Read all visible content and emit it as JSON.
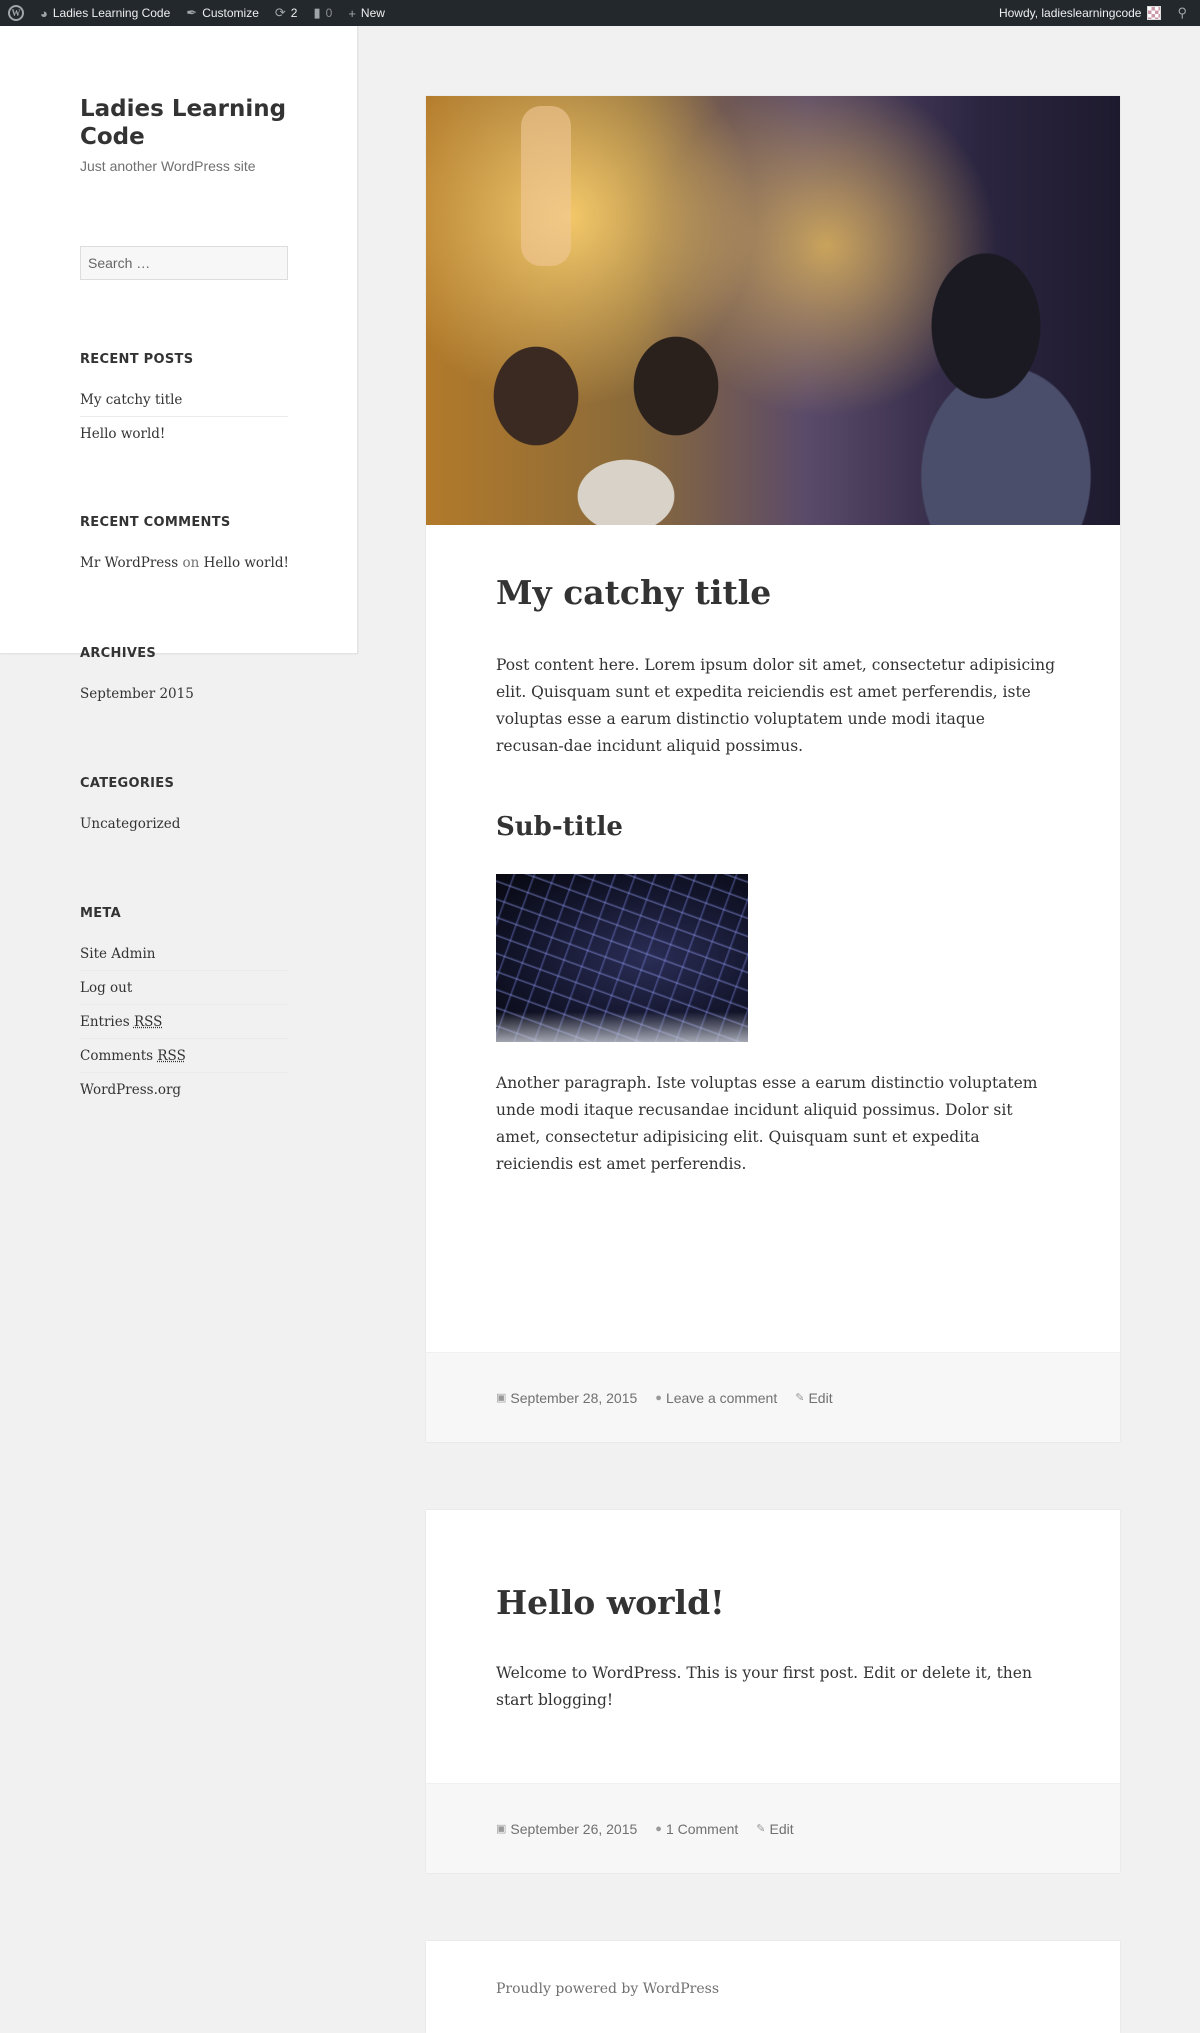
{
  "adminbar": {
    "site_name": "Ladies Learning Code",
    "customize": "Customize",
    "updates_count": "2",
    "comments_count": "0",
    "new_label": "New",
    "howdy": "Howdy, ladieslearningcode"
  },
  "site": {
    "title": "Ladies Learning Code",
    "description": "Just another WordPress site"
  },
  "search": {
    "placeholder": "Search …"
  },
  "widgets": {
    "recent_posts": {
      "title": "RECENT POSTS",
      "items": [
        "My catchy title",
        "Hello world!"
      ]
    },
    "recent_comments": {
      "title": "RECENT COMMENTS",
      "author": "Mr WordPress",
      "on": "on",
      "post": "Hello world!"
    },
    "archives": {
      "title": "ARCHIVES",
      "items": [
        "September 2015"
      ]
    },
    "categories": {
      "title": "CATEGORIES",
      "items": [
        "Uncategorized"
      ]
    },
    "meta": {
      "title": "META",
      "site_admin": "Site Admin",
      "log_out": "Log out",
      "entries_prefix": "Entries ",
      "comments_prefix": "Comments ",
      "rss": "RSS",
      "wordpress_org": "WordPress.org"
    }
  },
  "posts": [
    {
      "title": "My catchy title",
      "paragraph1": "Post content here.   Lorem ipsum dolor sit amet, consectetur adipisicing elit. Quisquam sunt et expedita reiciendis est amet perferendis, iste voluptas esse a earum distinctio voluptatem unde modi itaque recusan-dae incidunt aliquid possimus.",
      "subtitle": "Sub-title",
      "paragraph2": "Another paragraph. Iste voluptas esse a earum distinctio voluptatem unde modi itaque recusandae incidunt aliquid possimus. Dolor sit amet, consectetur adipisicing elit. Quisquam sunt et expedita reiciendis est amet perferendis.",
      "date": "September 28, 2015",
      "comments": "Leave a comment",
      "edit": "Edit"
    },
    {
      "title": "Hello world!",
      "paragraph1": "Welcome to WordPress. This is your first post. Edit or delete it, then start blogging!",
      "date": "September 26, 2015",
      "comments": "1 Comment",
      "edit": "Edit"
    }
  ],
  "footer": {
    "powered": "Proudly powered by WordPress"
  }
}
